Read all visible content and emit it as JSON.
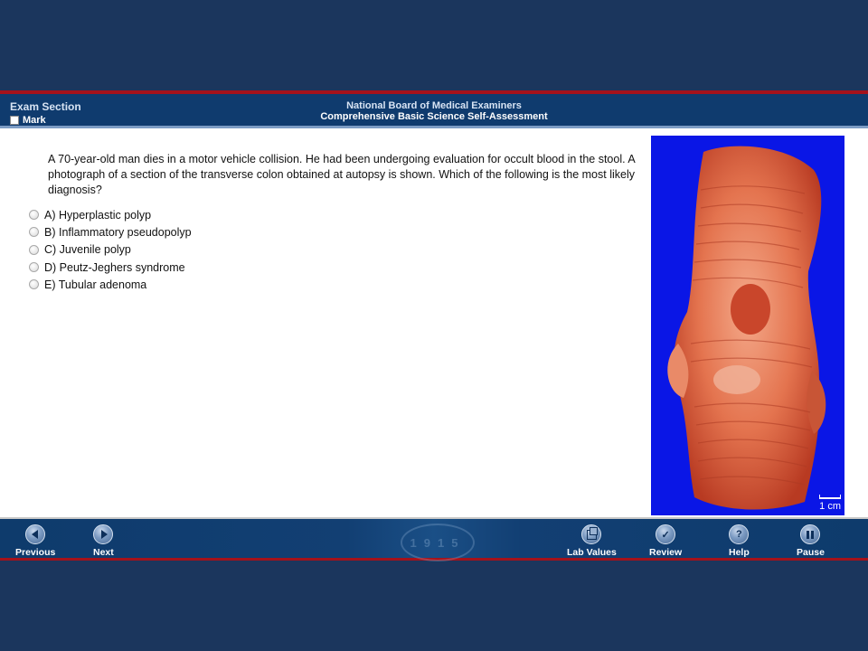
{
  "header": {
    "exam_section": "Exam Section",
    "mark_label": "Mark",
    "org": "National Board of Medical Examiners",
    "title": "Comprehensive Basic Science Self-Assessment"
  },
  "question": {
    "stem": "A 70-year-old man dies in a motor vehicle collision. He had been undergoing evaluation for occult blood in the stool. A photograph of a section of the transverse colon obtained at autopsy is shown. Which of the following is the most likely diagnosis?",
    "choices": [
      "A) Hyperplastic polyp",
      "B) Inflammatory pseudopolyp",
      "C) Juvenile polyp",
      "D) Peutz-Jeghers syndrome",
      "E) Tubular adenoma"
    ]
  },
  "image": {
    "scale_label": "1 cm"
  },
  "footer": {
    "seal_text": "1915",
    "previous": "Previous",
    "next": "Next",
    "lab_values": "Lab Values",
    "review": "Review",
    "help": "Help",
    "pause": "Pause"
  },
  "colors": {
    "page_bg": "#1b365d",
    "bar_bg": "#0f3b6e",
    "accent_red": "#a4121b",
    "photo_bg": "#0a16e6"
  }
}
